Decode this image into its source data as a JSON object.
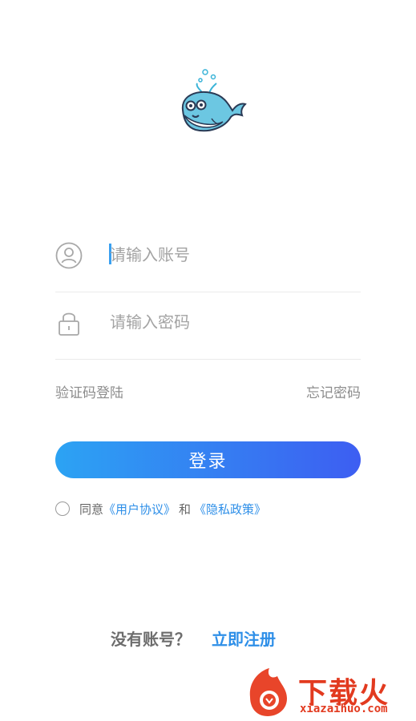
{
  "login": {
    "account_placeholder": "请输入账号",
    "password_placeholder": "请输入密码",
    "sms_login": "验证码登陆",
    "forgot_password": "忘记密码",
    "login_button": "登录"
  },
  "agreement": {
    "prefix": "同意",
    "user_agreement": "《用户协议》",
    "and": "和",
    "privacy_policy": "《隐私政策》",
    "checked": false
  },
  "register": {
    "question": "没有账号？",
    "link": "立即注册"
  },
  "watermark": {
    "text": "下载火",
    "url": "xiazaihuo.com"
  },
  "icons": {
    "logo": "whale-logo-icon",
    "account": "user-icon",
    "password": "lock-icon"
  },
  "colors": {
    "accent": "#2e8fe8",
    "button_start": "#2ca3f3",
    "button_end": "#3d5ef2"
  }
}
